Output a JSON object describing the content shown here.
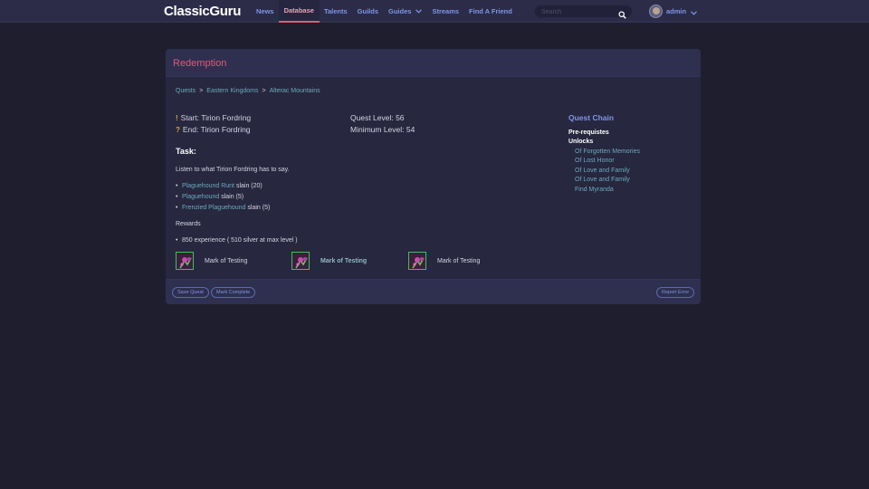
{
  "nav": {
    "logo": "ClassicGuru",
    "items": [
      {
        "label": "News"
      },
      {
        "label": "Database"
      },
      {
        "label": "Talents"
      },
      {
        "label": "Guilds"
      },
      {
        "label": "Guides"
      },
      {
        "label": "Streams"
      },
      {
        "label": "Find A Friend"
      }
    ],
    "search_placeholder": "Search",
    "user_name": "admin"
  },
  "quest": {
    "title": "Redemption",
    "breadcrumb": [
      "Quests",
      "Eastern Kingdoms",
      "Alterac Mountains"
    ],
    "start": "Start: Tirion Fordring",
    "end": "End: Tirion Fordring",
    "quest_level": "Quest Level: 56",
    "min_level": "Minimum Level: 54",
    "task_heading": "Task:",
    "task_description": "Listen to what Tirion Fordring has to say.",
    "objectives": [
      {
        "link": "Plaguehound Runt",
        "suffix": "slain (20)"
      },
      {
        "link": "Plaguehound",
        "suffix": "slain (5)"
      },
      {
        "link": "Frenzied Plaguehound",
        "suffix": "slain (5)"
      }
    ],
    "rewards_label": "Rewards",
    "reward_xp": "850 experience ( 510 silver at max level )",
    "reward_items": [
      "Mark of Testing",
      "Mark of Testing",
      "Mark of Testing"
    ]
  },
  "chain": {
    "title": "Quest Chain",
    "prereq_label": "Pre-requistes",
    "unlocks_label": "Unlocks",
    "unlocks": [
      "Of Forgotten Memories",
      "Of Lost Honor",
      "Of Love and Family",
      "Of Love and Family",
      "Find Myranda"
    ]
  },
  "footer": {
    "save": "Save Quest",
    "complete": "Mark Complete",
    "report": "Report Error"
  },
  "colors": {
    "background": "#1e1e2f",
    "panel": "#27273f",
    "accent_pink": "#e3577a",
    "nav_blue": "#7f95e6",
    "link_teal": "#6aa9bb"
  },
  "icons": {
    "search": "search-icon",
    "chevron": "chevron-down-icon",
    "reward_item": "flower-item-icon"
  }
}
